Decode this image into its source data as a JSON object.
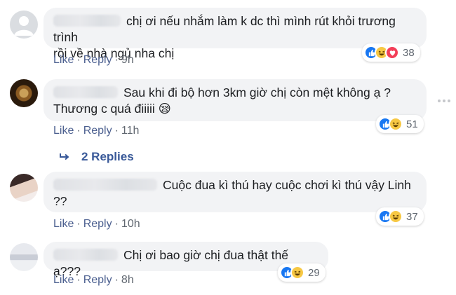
{
  "comments": [
    {
      "text": "chị ơi nếu nhắm làm k dc thì mình rút khỏi trương trình rồi về nhà ngủ nha chị",
      "line1": "chị ơi nếu nhắm làm k dc thì mình rút khỏi trương trình",
      "line2": "rồi về nhà ngủ nha chị",
      "like": "Like",
      "reply": "Reply",
      "time": "9h",
      "reaction_icons": [
        "like-icon",
        "haha-icon",
        "love-icon"
      ],
      "reaction_count": "38"
    },
    {
      "line1": "Sau khi đi bộ hơn 3km giờ chị còn mệt không ạ ?",
      "line2": "Thương c quá điiiii",
      "emoji": "😪",
      "like": "Like",
      "reply": "Reply",
      "time": "11h",
      "reaction_icons": [
        "like-icon",
        "haha-icon"
      ],
      "reaction_count": "51"
    },
    {
      "line1": "Cuộc đua kì thú hay cuộc chơi kì thú vậy Linh",
      "line2": "??",
      "like": "Like",
      "reply": "Reply",
      "time": "10h",
      "reaction_icons": [
        "like-icon",
        "haha-icon"
      ],
      "reaction_count": "37"
    },
    {
      "line1": "Chị ơi bao giờ chị đua thật thế ạ???",
      "like": "Like",
      "reply": "Reply",
      "time": "8h",
      "reaction_icons": [
        "like-icon",
        "haha-icon"
      ],
      "reaction_count": "29"
    }
  ],
  "replies_link": "2 Replies",
  "colors": {
    "bubble": "#f2f3f5",
    "link": "#4b5f8f",
    "replies": "#385898",
    "like_blue": "#1877f2",
    "haha_yellow": "#f7c844",
    "love_red": "#f33e58"
  }
}
